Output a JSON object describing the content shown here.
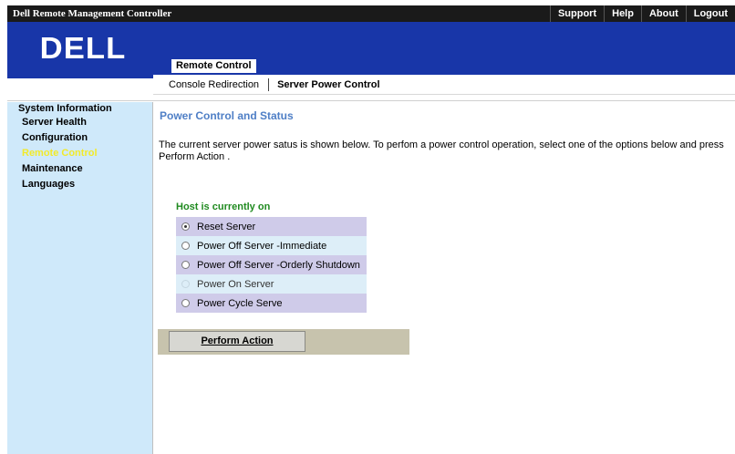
{
  "window": {
    "title": "Dell Remote Management Controller"
  },
  "toplinks": [
    "Support",
    "Help",
    "About",
    "Logout"
  ],
  "banner": {
    "logo_text": "DELL",
    "active_tab": "Remote Control"
  },
  "subnav": {
    "items": [
      "Console Redirection",
      "Server Power Control"
    ],
    "active": "Server Power Control"
  },
  "sidebar": {
    "items": [
      {
        "label": "System Information"
      },
      {
        "label": "Server Health"
      },
      {
        "label": "Configuration"
      },
      {
        "label": "Remote Control",
        "selected": true
      },
      {
        "label": "Maintenance"
      },
      {
        "label": "Languages"
      }
    ]
  },
  "main": {
    "title": "Power Control and Status",
    "description": "The current server power satus is shown below. To perfom a power control operation, select one of the options below and press Perform Action .",
    "host_status": "Host is currently on",
    "options": [
      {
        "label": "Reset Server",
        "checked": true
      },
      {
        "label": "Power Off Server -Immediate",
        "checked": false
      },
      {
        "label": "Power Off Server -Orderly Shutdown",
        "checked": false
      },
      {
        "label": "Power On Server",
        "checked": false,
        "disabled": true
      },
      {
        "label": "Power Cycle Serve",
        "checked": false
      }
    ],
    "action_button": "Perform Action"
  },
  "colors": {
    "banner": "#1836a8",
    "sidebar": "#cfe9fa",
    "title": "#4f7fc6",
    "status_green": "#1f8a1f",
    "selected_nav": "#f2ea2a"
  }
}
